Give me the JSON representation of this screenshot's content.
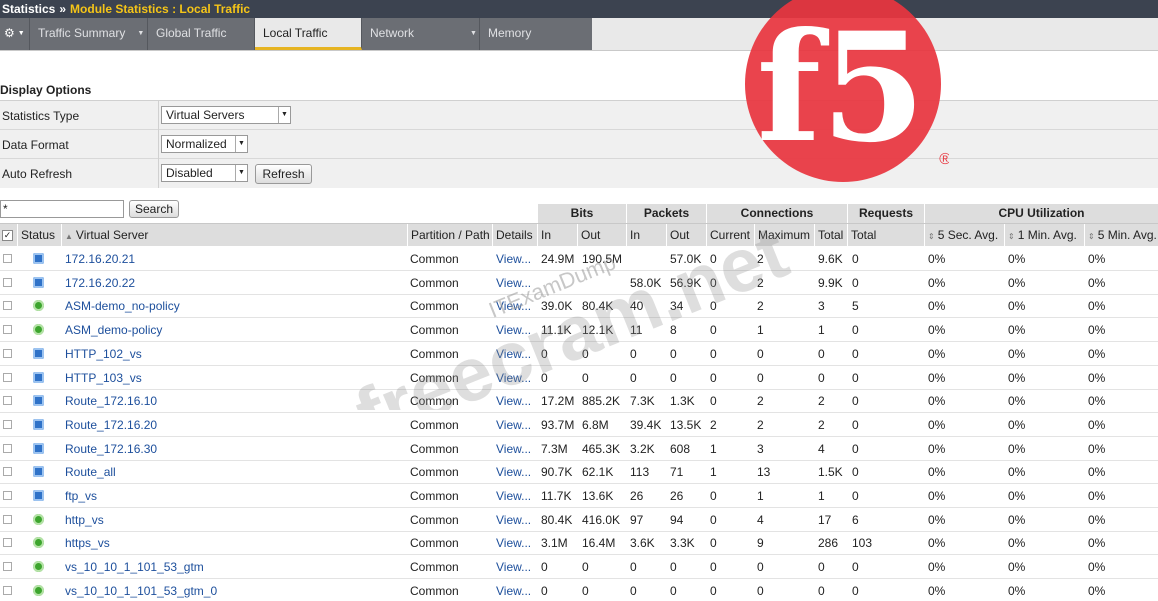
{
  "breadcrumb": {
    "root": "Statistics",
    "separator": "»",
    "current": "Module Statistics : Local Traffic"
  },
  "tabs": [
    {
      "label": "Traffic Summary",
      "has_menu": true
    },
    {
      "label": "Global Traffic",
      "has_menu": false
    },
    {
      "label": "Local Traffic",
      "has_menu": false,
      "active": true
    },
    {
      "label": "Network",
      "has_menu": true
    },
    {
      "label": "Memory",
      "has_menu": false
    }
  ],
  "display_options": {
    "title": "Display Options",
    "statistics_type": {
      "label": "Statistics Type",
      "value": "Virtual Servers"
    },
    "data_format": {
      "label": "Data Format",
      "value": "Normalized"
    },
    "auto_refresh": {
      "label": "Auto Refresh",
      "value": "Disabled",
      "button": "Refresh"
    }
  },
  "search": {
    "value": "*",
    "button": "Search"
  },
  "groups": {
    "bits": "Bits",
    "packets": "Packets",
    "connections": "Connections",
    "requests": "Requests",
    "cpu": "CPU Utilization"
  },
  "columns": {
    "status": "Status",
    "virtual_server": "Virtual Server",
    "partition": "Partition / Path",
    "details": "Details",
    "bits_in": "In",
    "bits_out": "Out",
    "pkts_in": "In",
    "pkts_out": "Out",
    "current": "Current",
    "maximum": "Maximum",
    "total": "Total",
    "req_total": "Total",
    "cpu_5s": "5 Sec. Avg.",
    "cpu_1m": "1 Min. Avg.",
    "cpu_5m": "5 Min. Avg."
  },
  "rows": [
    {
      "status": "blue",
      "name": "172.16.20.21",
      "partition": "Common",
      "details": "View...",
      "bits_in": "24.9M",
      "bits_out": "190.5M",
      "pkts_in": "",
      "pkts_out": "57.0K",
      "current": "0",
      "maximum": "2",
      "total": "9.6K",
      "requests": "0",
      "cpu5s": "0%",
      "cpu1m": "0%",
      "cpu5m": "0%"
    },
    {
      "status": "blue",
      "name": "172.16.20.22",
      "partition": "Common",
      "details": "View...",
      "bits_in": "",
      "bits_out": "",
      "pkts_in": "58.0K",
      "pkts_out": "56.9K",
      "current": "0",
      "maximum": "2",
      "total": "9.9K",
      "requests": "0",
      "cpu5s": "0%",
      "cpu1m": "0%",
      "cpu5m": "0%"
    },
    {
      "status": "green",
      "name": "ASM-demo_no-policy",
      "partition": "Common",
      "details": "View...",
      "bits_in": "39.0K",
      "bits_out": "80.4K",
      "pkts_in": "40",
      "pkts_out": "34",
      "current": "0",
      "maximum": "2",
      "total": "3",
      "requests": "5",
      "cpu5s": "0%",
      "cpu1m": "0%",
      "cpu5m": "0%"
    },
    {
      "status": "green",
      "name": "ASM_demo-policy",
      "partition": "Common",
      "details": "View...",
      "bits_in": "11.1K",
      "bits_out": "12.1K",
      "pkts_in": "11",
      "pkts_out": "8",
      "current": "0",
      "maximum": "1",
      "total": "1",
      "requests": "0",
      "cpu5s": "0%",
      "cpu1m": "0%",
      "cpu5m": "0%"
    },
    {
      "status": "blue",
      "name": "HTTP_102_vs",
      "partition": "Common",
      "details": "View...",
      "bits_in": "0",
      "bits_out": "0",
      "pkts_in": "0",
      "pkts_out": "0",
      "current": "0",
      "maximum": "0",
      "total": "0",
      "requests": "0",
      "cpu5s": "0%",
      "cpu1m": "0%",
      "cpu5m": "0%"
    },
    {
      "status": "blue",
      "name": "HTTP_103_vs",
      "partition": "Common",
      "details": "View...",
      "bits_in": "0",
      "bits_out": "0",
      "pkts_in": "0",
      "pkts_out": "0",
      "current": "0",
      "maximum": "0",
      "total": "0",
      "requests": "0",
      "cpu5s": "0%",
      "cpu1m": "0%",
      "cpu5m": "0%"
    },
    {
      "status": "blue",
      "name": "Route_172.16.10",
      "partition": "Common",
      "details": "View...",
      "bits_in": "17.2M",
      "bits_out": "885.2K",
      "pkts_in": "7.3K",
      "pkts_out": "1.3K",
      "current": "0",
      "maximum": "2",
      "total": "2",
      "requests": "0",
      "cpu5s": "0%",
      "cpu1m": "0%",
      "cpu5m": "0%"
    },
    {
      "status": "blue",
      "name": "Route_172.16.20",
      "partition": "Common",
      "details": "View...",
      "bits_in": "93.7M",
      "bits_out": "6.8M",
      "pkts_in": "39.4K",
      "pkts_out": "13.5K",
      "current": "2",
      "maximum": "2",
      "total": "2",
      "requests": "0",
      "cpu5s": "0%",
      "cpu1m": "0%",
      "cpu5m": "0%"
    },
    {
      "status": "blue",
      "name": "Route_172.16.30",
      "partition": "Common",
      "details": "View...",
      "bits_in": "7.3M",
      "bits_out": "465.3K",
      "pkts_in": "3.2K",
      "pkts_out": "608",
      "current": "1",
      "maximum": "3",
      "total": "4",
      "requests": "0",
      "cpu5s": "0%",
      "cpu1m": "0%",
      "cpu5m": "0%"
    },
    {
      "status": "blue",
      "name": "Route_all",
      "partition": "Common",
      "details": "View...",
      "bits_in": "90.7K",
      "bits_out": "62.1K",
      "pkts_in": "113",
      "pkts_out": "71",
      "current": "1",
      "maximum": "13",
      "total": "1.5K",
      "requests": "0",
      "cpu5s": "0%",
      "cpu1m": "0%",
      "cpu5m": "0%"
    },
    {
      "status": "blue",
      "name": "ftp_vs",
      "partition": "Common",
      "details": "View...",
      "bits_in": "11.7K",
      "bits_out": "13.6K",
      "pkts_in": "26",
      "pkts_out": "26",
      "current": "0",
      "maximum": "1",
      "total": "1",
      "requests": "0",
      "cpu5s": "0%",
      "cpu1m": "0%",
      "cpu5m": "0%"
    },
    {
      "status": "green",
      "name": "http_vs",
      "partition": "Common",
      "details": "View...",
      "bits_in": "80.4K",
      "bits_out": "416.0K",
      "pkts_in": "97",
      "pkts_out": "94",
      "current": "0",
      "maximum": "4",
      "total": "17",
      "requests": "6",
      "cpu5s": "0%",
      "cpu1m": "0%",
      "cpu5m": "0%"
    },
    {
      "status": "green",
      "name": "https_vs",
      "partition": "Common",
      "details": "View...",
      "bits_in": "3.1M",
      "bits_out": "16.4M",
      "pkts_in": "3.6K",
      "pkts_out": "3.3K",
      "current": "0",
      "maximum": "9",
      "total": "286",
      "requests": "103",
      "cpu5s": "0%",
      "cpu1m": "0%",
      "cpu5m": "0%"
    },
    {
      "status": "green",
      "name": "vs_10_10_1_101_53_gtm",
      "partition": "Common",
      "details": "View...",
      "bits_in": "0",
      "bits_out": "0",
      "pkts_in": "0",
      "pkts_out": "0",
      "current": "0",
      "maximum": "0",
      "total": "0",
      "requests": "0",
      "cpu5s": "0%",
      "cpu1m": "0%",
      "cpu5m": "0%"
    },
    {
      "status": "green",
      "name": "vs_10_10_1_101_53_gtm_0",
      "partition": "Common",
      "details": "View...",
      "bits_in": "0",
      "bits_out": "0",
      "pkts_in": "0",
      "pkts_out": "0",
      "current": "0",
      "maximum": "0",
      "total": "0",
      "requests": "0",
      "cpu5s": "0%",
      "cpu1m": "0%",
      "cpu5m": "0%"
    }
  ],
  "logo": {
    "text": "f5",
    "mark": "®",
    "color": "#e8363f"
  },
  "watermark": {
    "line1": "ITExamDump",
    "line2": "freecram.net"
  },
  "colors": {
    "blue_status": "#2f72c8",
    "green_status": "#3da52e",
    "link": "#1d4f9c",
    "tab_active_underline": "#e6b422"
  }
}
